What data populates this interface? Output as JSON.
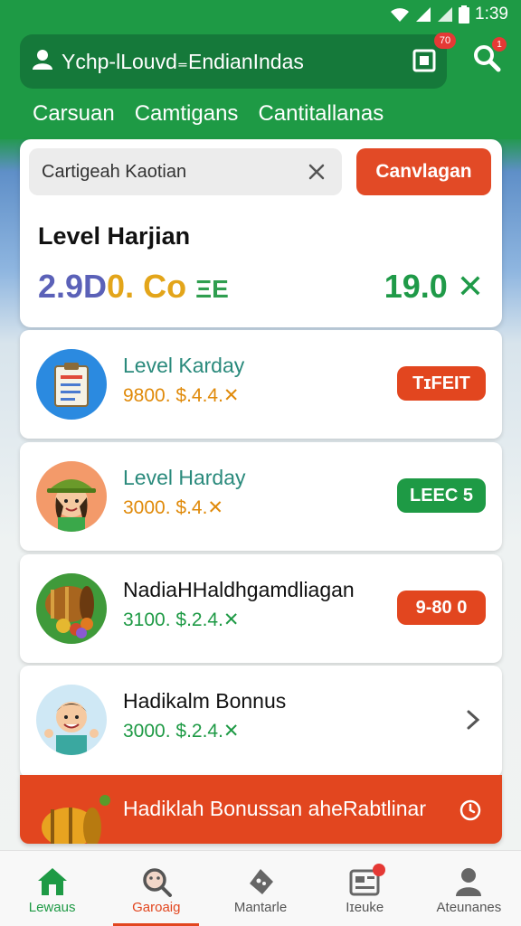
{
  "status_bar": {
    "time": "1:39"
  },
  "header": {
    "search_text": "Ychp-lLouvd₌EndianIndas",
    "notification_badge": "70",
    "search_badge": "1",
    "tabs": [
      "Carsuan",
      "Camtigans",
      "Cantitallanas"
    ]
  },
  "top_card": {
    "input_value": "Cartigeah Kaotian",
    "button_label": "Canvlagan",
    "level_title": "Level  Harjian",
    "stat_left_1": "2.9D",
    "stat_left_2": "0. Co",
    "stat_left_3": "ΞE",
    "stat_right": "19.0 ✕"
  },
  "list": [
    {
      "title": "Level Karday",
      "subtitle": "9800. $.4.4.✕",
      "action": "TɪFEIT",
      "title_color": "#2a8a7c",
      "subtitle_color": "#e08a0a",
      "action_color": "#e2461f",
      "icon": "clipboard-icon"
    },
    {
      "title": "Level Harday",
      "subtitle": "3000. $.4.✕",
      "action": "LEEC 5",
      "title_color": "#2a8a7c",
      "subtitle_color": "#e08a0a",
      "action_color": "#1e9a45",
      "icon": "farmer-girl-avatar"
    },
    {
      "title": "NadiaHHaldhgamdliagan",
      "subtitle": "3100. $.2.4.✕",
      "action": "9-80 0",
      "title_color": "#111111",
      "subtitle_color": "#1e9a45",
      "action_color": "#e2461f",
      "icon": "barrel-fruit-icon"
    },
    {
      "title": "Hadikalm Bonnus",
      "subtitle": "3000. $.2.4.✕",
      "action": "",
      "title_color": "#111111",
      "subtitle_color": "#1e9a45",
      "action_color": "",
      "icon": "farmer-boy-avatar"
    }
  ],
  "bonus_banner": {
    "text": "Hadiklah Bonussan aheRabtlinar"
  },
  "bottom_nav": [
    {
      "label": "Lewaus",
      "icon": "home-icon"
    },
    {
      "label": "Garoaig",
      "icon": "search-icon"
    },
    {
      "label": "Mantarle",
      "icon": "game-icon"
    },
    {
      "label": "Iɪeuke",
      "icon": "news-icon"
    },
    {
      "label": "Ateunanes",
      "icon": "profile-icon"
    }
  ]
}
